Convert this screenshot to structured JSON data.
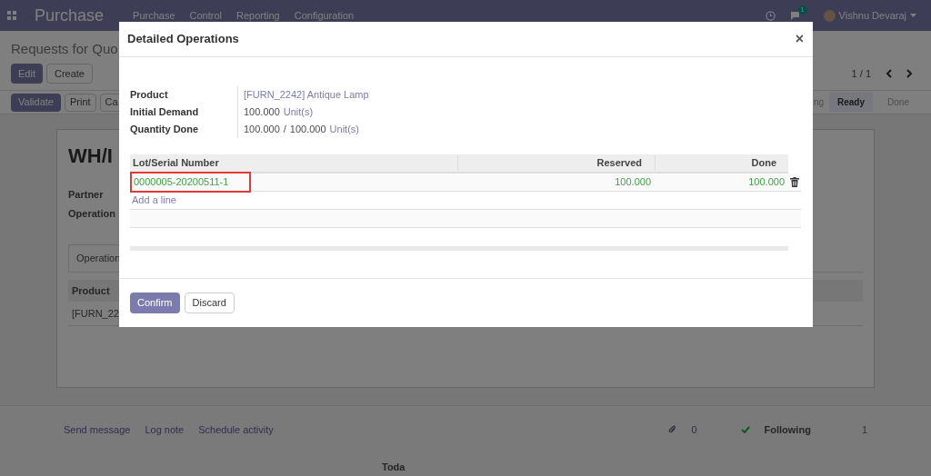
{
  "navbar": {
    "app_title": "Purchase",
    "menu": [
      "Purchase",
      "Control",
      "Reporting",
      "Configuration"
    ],
    "message_count": "1",
    "user": "Vishnu Devaraj"
  },
  "control_panel": {
    "breadcrumb": "Requests for Quo",
    "buttons": [
      "Edit",
      "Create"
    ],
    "pager": "1 / 1"
  },
  "statusbar": {
    "buttons": [
      "Validate",
      "Print",
      "Ca"
    ],
    "stages": [
      {
        "label": "ng",
        "selected": false
      },
      {
        "label": "Ready",
        "selected": true
      },
      {
        "label": "Done",
        "selected": false
      }
    ]
  },
  "sheet": {
    "title": "WH/I",
    "fields": [
      "Partner",
      "Operation"
    ],
    "tab": "Operation",
    "column": "Product",
    "cell": "[FURN_22"
  },
  "chatter": {
    "actions": [
      "Send message",
      "Log note",
      "Schedule activity"
    ],
    "attachments": "0",
    "following": "Following",
    "followers": "1",
    "date_separator": "Toda"
  },
  "dialog": {
    "title": "Detailed Operations",
    "close": "×",
    "fields": [
      {
        "label": "Product",
        "kind": "link",
        "value": "[FURN_2242] Antique Lamp"
      },
      {
        "label": "Initial Demand",
        "kind": "quantity",
        "value": "100.000",
        "unit": "Unit(s)"
      },
      {
        "label": "Quantity Done",
        "kind": "ratio",
        "value": "100.000",
        "separator": "/",
        "total": "100.000",
        "unit": "Unit(s)"
      }
    ],
    "table": {
      "columns": [
        "Lot/Serial Number",
        "Reserved",
        "Done"
      ],
      "rows": [
        {
          "lot": "0000005-20200511-1",
          "reserved": "100.000",
          "done": "100.000",
          "highlighted": true
        }
      ],
      "add_line": "Add a line"
    },
    "buttons": [
      "Confirm",
      "Discard"
    ]
  }
}
